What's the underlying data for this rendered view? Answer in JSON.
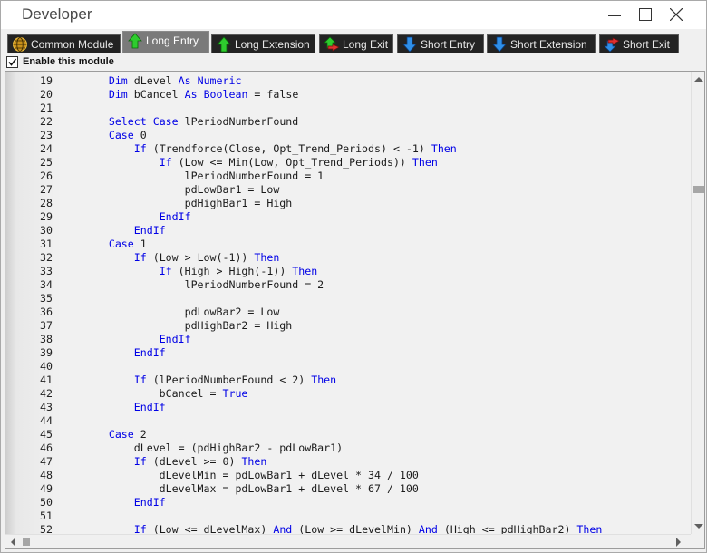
{
  "window": {
    "title": "Developer"
  },
  "tabs": [
    {
      "label": "Common Module",
      "icon": "globe-icon",
      "active": false
    },
    {
      "label": "Long Entry",
      "icon": "green-up-arrow-icon",
      "active": true
    },
    {
      "label": "Long Extension",
      "icon": "green-up-arrow-icon",
      "active": false
    },
    {
      "label": "Long Exit",
      "icon": "green-red-exit-arrow-icon",
      "active": false
    },
    {
      "label": "Short Entry",
      "icon": "blue-down-arrow-icon",
      "active": false
    },
    {
      "label": "Short Extension",
      "icon": "blue-down-arrow-icon",
      "active": false
    },
    {
      "label": "Short Exit",
      "icon": "blue-red-exit-arrow-icon",
      "active": false
    }
  ],
  "module": {
    "enable_label": "Enable this module",
    "enabled": true
  },
  "colors": {
    "keyword": "#0000e6",
    "tab_bg": "#232323",
    "tab_active_bg": "#7a7a7a",
    "editor_bg": "#f1f1f1"
  },
  "editor": {
    "lines": [
      {
        "n": "19",
        "t": "        Dim dLevel As Numeric"
      },
      {
        "n": "20",
        "t": "        Dim bCancel As Boolean = false"
      },
      {
        "n": "21",
        "t": ""
      },
      {
        "n": "22",
        "t": "        Select Case lPeriodNumberFound"
      },
      {
        "n": "23",
        "t": "        Case 0"
      },
      {
        "n": "24",
        "t": "            If (Trendforce(Close, Opt_Trend_Periods) < -1) Then"
      },
      {
        "n": "25",
        "t": "                If (Low <= Min(Low, Opt_Trend_Periods)) Then"
      },
      {
        "n": "26",
        "t": "                    lPeriodNumberFound = 1"
      },
      {
        "n": "27",
        "t": "                    pdLowBar1 = Low"
      },
      {
        "n": "28",
        "t": "                    pdHighBar1 = High"
      },
      {
        "n": "29",
        "t": "                EndIf"
      },
      {
        "n": "30",
        "t": "            EndIf"
      },
      {
        "n": "31",
        "t": "        Case 1"
      },
      {
        "n": "32",
        "t": "            If (Low > Low(-1)) Then"
      },
      {
        "n": "33",
        "t": "                If (High > High(-1)) Then"
      },
      {
        "n": "34",
        "t": "                    lPeriodNumberFound = 2"
      },
      {
        "n": "35",
        "t": ""
      },
      {
        "n": "36",
        "t": "                    pdLowBar2 = Low"
      },
      {
        "n": "37",
        "t": "                    pdHighBar2 = High"
      },
      {
        "n": "38",
        "t": "                EndIf"
      },
      {
        "n": "39",
        "t": "            EndIf"
      },
      {
        "n": "40",
        "t": ""
      },
      {
        "n": "41",
        "t": "            If (lPeriodNumberFound < 2) Then"
      },
      {
        "n": "42",
        "t": "                bCancel = True"
      },
      {
        "n": "43",
        "t": "            EndIf"
      },
      {
        "n": "44",
        "t": ""
      },
      {
        "n": "45",
        "t": "        Case 2"
      },
      {
        "n": "46",
        "t": "            dLevel = (pdHighBar2 - pdLowBar1)"
      },
      {
        "n": "47",
        "t": "            If (dLevel >= 0) Then"
      },
      {
        "n": "48",
        "t": "                dLevelMin = pdLowBar1 + dLevel * 34 / 100"
      },
      {
        "n": "49",
        "t": "                dLevelMax = pdLowBar1 + dLevel * 67 / 100"
      },
      {
        "n": "50",
        "t": "            EndIf"
      },
      {
        "n": "51",
        "t": ""
      },
      {
        "n": "52",
        "t": "            If (Low <= dLevelMax) And (Low >= dLevelMin) And (High <= pdHighBar2) Then"
      }
    ]
  }
}
